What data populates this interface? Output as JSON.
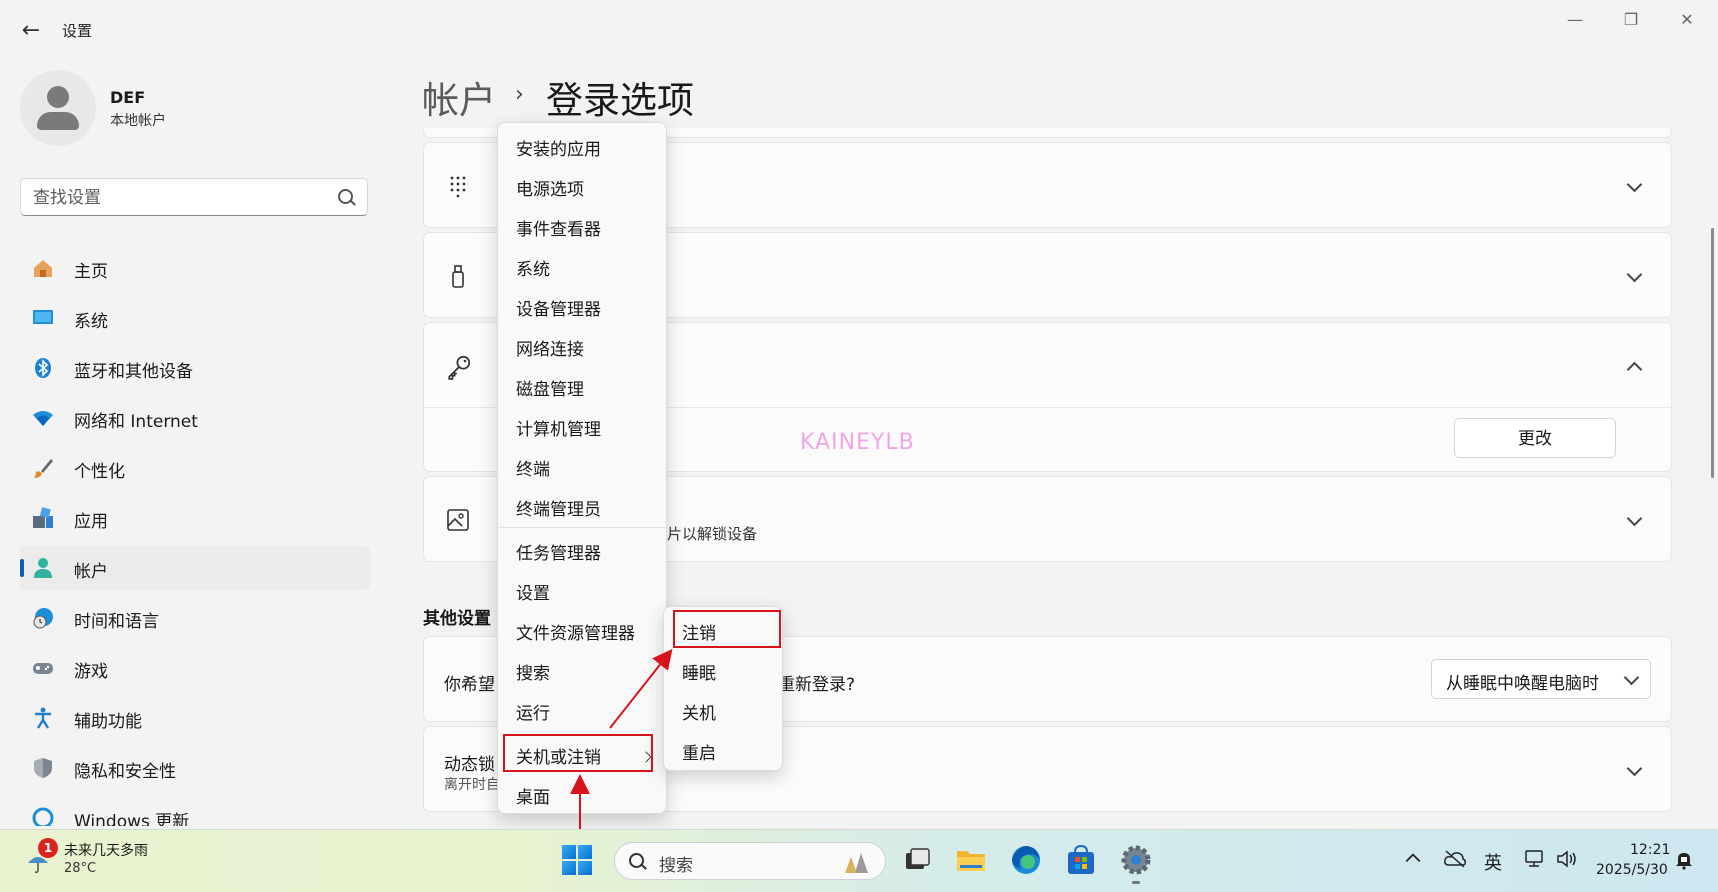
{
  "window": {
    "title": "设置",
    "back_glyph": "←",
    "minimize_glyph": "—",
    "restore_glyph": "❐",
    "close_glyph": "✕"
  },
  "user": {
    "name": "DEF",
    "account_type": "本地帐户"
  },
  "search": {
    "placeholder": "查找设置"
  },
  "nav": {
    "items": [
      {
        "label": "主页",
        "icon": "home-icon"
      },
      {
        "label": "系统",
        "icon": "system-icon"
      },
      {
        "label": "蓝牙和其他设备",
        "icon": "bluetooth-icon"
      },
      {
        "label": "网络和 Internet",
        "icon": "wifi-icon"
      },
      {
        "label": "个性化",
        "icon": "brush-icon"
      },
      {
        "label": "应用",
        "icon": "apps-icon"
      },
      {
        "label": "帐户",
        "icon": "account-icon",
        "active": true
      },
      {
        "label": "时间和语言",
        "icon": "globe-clock-icon"
      },
      {
        "label": "游戏",
        "icon": "gamepad-icon"
      },
      {
        "label": "辅助功能",
        "icon": "accessibility-icon"
      },
      {
        "label": "隐私和安全性",
        "icon": "shield-icon"
      },
      {
        "label": "Windows 更新",
        "icon": "update-icon"
      }
    ]
  },
  "breadcrumb": {
    "root": "帐户",
    "separator": "›",
    "current": "登录选项"
  },
  "cards": {
    "picture_partial_text": "片以解锁设备",
    "change_button": "更改"
  },
  "watermark": "KAINEYLB",
  "other_settings": {
    "title": "其他设置",
    "signin_prompt_prefix": "你希望",
    "signin_prompt_suffix": "重新登录?",
    "signin_dropdown_value": "从睡眠中唤醒电脑时",
    "dynamic_lock_title": "动态锁",
    "dynamic_lock_desc": "离开时自"
  },
  "context_menu": {
    "items": [
      "安装的应用",
      "电源选项",
      "事件查看器",
      "系统",
      "设备管理器",
      "网络连接",
      "磁盘管理",
      "计算机管理",
      "终端",
      "终端管理员",
      "任务管理器",
      "设置",
      "文件资源管理器",
      "搜索",
      "运行",
      "关机或注销",
      "桌面"
    ]
  },
  "submenu": {
    "items": [
      "注销",
      "睡眠",
      "关机",
      "重启"
    ]
  },
  "taskbar": {
    "weather_badge": "1",
    "weather_title": "未来几天多雨",
    "weather_temp": "28°C",
    "search_placeholder": "搜索",
    "ime": "英",
    "time": "12:21",
    "date": "2025/5/30"
  },
  "colors": {
    "accent": "#0a5fb4",
    "highlight_box": "#d7131b",
    "watermark": "#f0a6e6"
  }
}
